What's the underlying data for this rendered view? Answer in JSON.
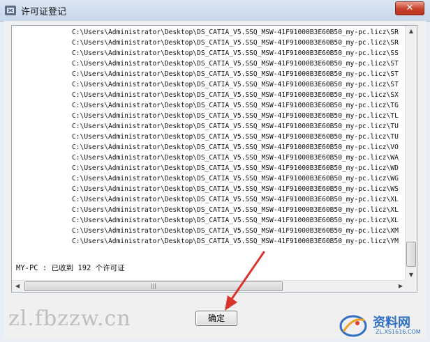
{
  "window": {
    "title": "许可证登记",
    "close_label": "✕"
  },
  "license_paths": [
    "C:\\Users\\Administrator\\Desktop\\DS_CATIA_V5.SSQ_MSW-41F91000B3E60B50_my-pc.licz\\SR",
    "C:\\Users\\Administrator\\Desktop\\DS_CATIA_V5.SSQ_MSW-41F91000B3E60B50_my-pc.licz\\SR",
    "C:\\Users\\Administrator\\Desktop\\DS_CATIA_V5.SSQ_MSW-41F91000B3E60B50_my-pc.licz\\SS",
    "C:\\Users\\Administrator\\Desktop\\DS_CATIA_V5.SSQ_MSW-41F91000B3E60B50_my-pc.licz\\ST",
    "C:\\Users\\Administrator\\Desktop\\DS_CATIA_V5.SSQ_MSW-41F91000B3E60B50_my-pc.licz\\ST",
    "C:\\Users\\Administrator\\Desktop\\DS_CATIA_V5.SSQ_MSW-41F91000B3E60B50_my-pc.licz\\ST",
    "C:\\Users\\Administrator\\Desktop\\DS_CATIA_V5.SSQ_MSW-41F91000B3E60B50_my-pc.licz\\SX",
    "C:\\Users\\Administrator\\Desktop\\DS_CATIA_V5.SSQ_MSW-41F91000B3E60B50_my-pc.licz\\TG",
    "C:\\Users\\Administrator\\Desktop\\DS_CATIA_V5.SSQ_MSW-41F91000B3E60B50_my-pc.licz\\TL",
    "C:\\Users\\Administrator\\Desktop\\DS_CATIA_V5.SSQ_MSW-41F91000B3E60B50_my-pc.licz\\TU",
    "C:\\Users\\Administrator\\Desktop\\DS_CATIA_V5.SSQ_MSW-41F91000B3E60B50_my-pc.licz\\TU",
    "C:\\Users\\Administrator\\Desktop\\DS_CATIA_V5.SSQ_MSW-41F91000B3E60B50_my-pc.licz\\VO",
    "C:\\Users\\Administrator\\Desktop\\DS_CATIA_V5.SSQ_MSW-41F91000B3E60B50_my-pc.licz\\WA",
    "C:\\Users\\Administrator\\Desktop\\DS_CATIA_V5.SSQ_MSW-41F91000B3E60B50_my-pc.licz\\WD",
    "C:\\Users\\Administrator\\Desktop\\DS_CATIA_V5.SSQ_MSW-41F91000B3E60B50_my-pc.licz\\WG",
    "C:\\Users\\Administrator\\Desktop\\DS_CATIA_V5.SSQ_MSW-41F91000B3E60B50_my-pc.licz\\WS",
    "C:\\Users\\Administrator\\Desktop\\DS_CATIA_V5.SSQ_MSW-41F91000B3E60B50_my-pc.licz\\XL",
    "C:\\Users\\Administrator\\Desktop\\DS_CATIA_V5.SSQ_MSW-41F91000B3E60B50_my-pc.licz\\XL",
    "C:\\Users\\Administrator\\Desktop\\DS_CATIA_V5.SSQ_MSW-41F91000B3E60B50_my-pc.licz\\XL",
    "C:\\Users\\Administrator\\Desktop\\DS_CATIA_V5.SSQ_MSW-41F91000B3E60B50_my-pc.licz\\XM",
    "C:\\Users\\Administrator\\Desktop\\DS_CATIA_V5.SSQ_MSW-41F91000B3E60B50_my-pc.licz\\YM"
  ],
  "summary": "MY-PC : 已收到 192 个许可证",
  "hscroll_grip": "|||",
  "ok_label": "确定",
  "watermark": {
    "left_text": "zl.fbzzw.cn",
    "logo_cn": "资料网",
    "logo_url": "ZL.XS1616.COM"
  },
  "colors": {
    "annotation_arrow": "#d9342b",
    "logo_blue": "#2f6fc4"
  }
}
